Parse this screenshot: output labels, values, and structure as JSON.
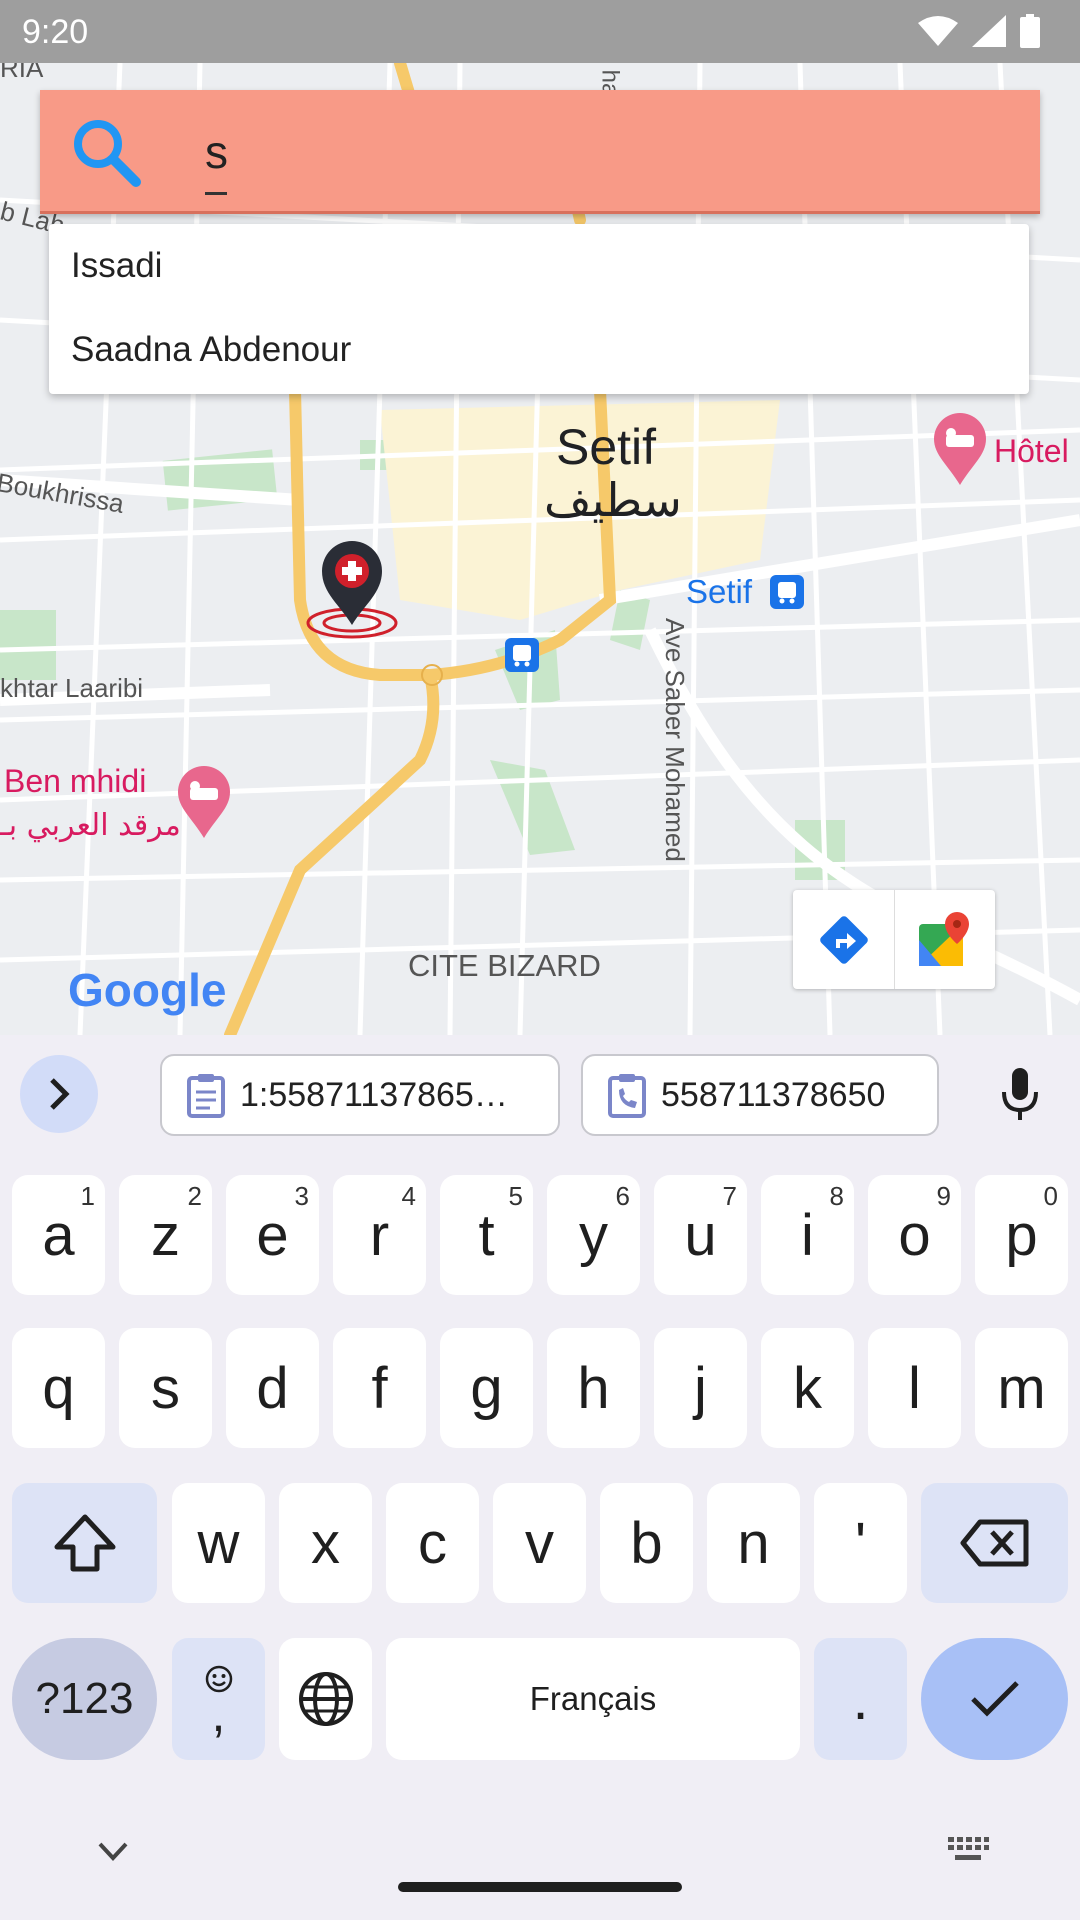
{
  "status_bar": {
    "time": "9:20"
  },
  "search": {
    "value": "s",
    "placeholder": ""
  },
  "suggestions": [
    "Issadi",
    "Saadna Abdenour"
  ],
  "map": {
    "labels": {
      "city_latin": "Setif",
      "city_arabic": "سطيف",
      "hotel": "Hôtel",
      "transit_station": "Setif",
      "road_boukhrissa": "Boukhrissa",
      "road_laaribi": "khtar Laaribi",
      "road_saber": "Ave Saber Mohamed",
      "poi_ben_mhidi": "Ben mhidi",
      "poi_ben_mhidi_ar": "مرقد العربي بـ",
      "district": "CITE BIZARD",
      "logo": "Google",
      "top_left_partial": "RIA",
      "left_partial": "b Lah",
      "top_road_partial": "har"
    }
  },
  "keyboard": {
    "clipboard_chips": [
      "1:55871137865…",
      "558711378650"
    ],
    "row1": [
      {
        "key": "a",
        "hint": "1"
      },
      {
        "key": "z",
        "hint": "2"
      },
      {
        "key": "e",
        "hint": "3"
      },
      {
        "key": "r",
        "hint": "4"
      },
      {
        "key": "t",
        "hint": "5"
      },
      {
        "key": "y",
        "hint": "6"
      },
      {
        "key": "u",
        "hint": "7"
      },
      {
        "key": "i",
        "hint": "8"
      },
      {
        "key": "o",
        "hint": "9"
      },
      {
        "key": "p",
        "hint": "0"
      }
    ],
    "row2": [
      "q",
      "s",
      "d",
      "f",
      "g",
      "h",
      "j",
      "k",
      "l",
      "m"
    ],
    "row3": [
      "w",
      "x",
      "c",
      "v",
      "b",
      "n",
      "'"
    ],
    "symbols_label": "?123",
    "emoji_comma_label": ",",
    "space_label": "Français",
    "period_label": "."
  },
  "colors": {
    "search_bar": "#f89a87",
    "search_icon": "#2196f3",
    "keyboard_bg": "#f0eef5",
    "key_mod": "#dde3f6",
    "enter_key": "#a8c0f6",
    "marker": "#d0202b",
    "hotel_pink": "#d81b60",
    "transit_blue": "#1a73e8"
  }
}
